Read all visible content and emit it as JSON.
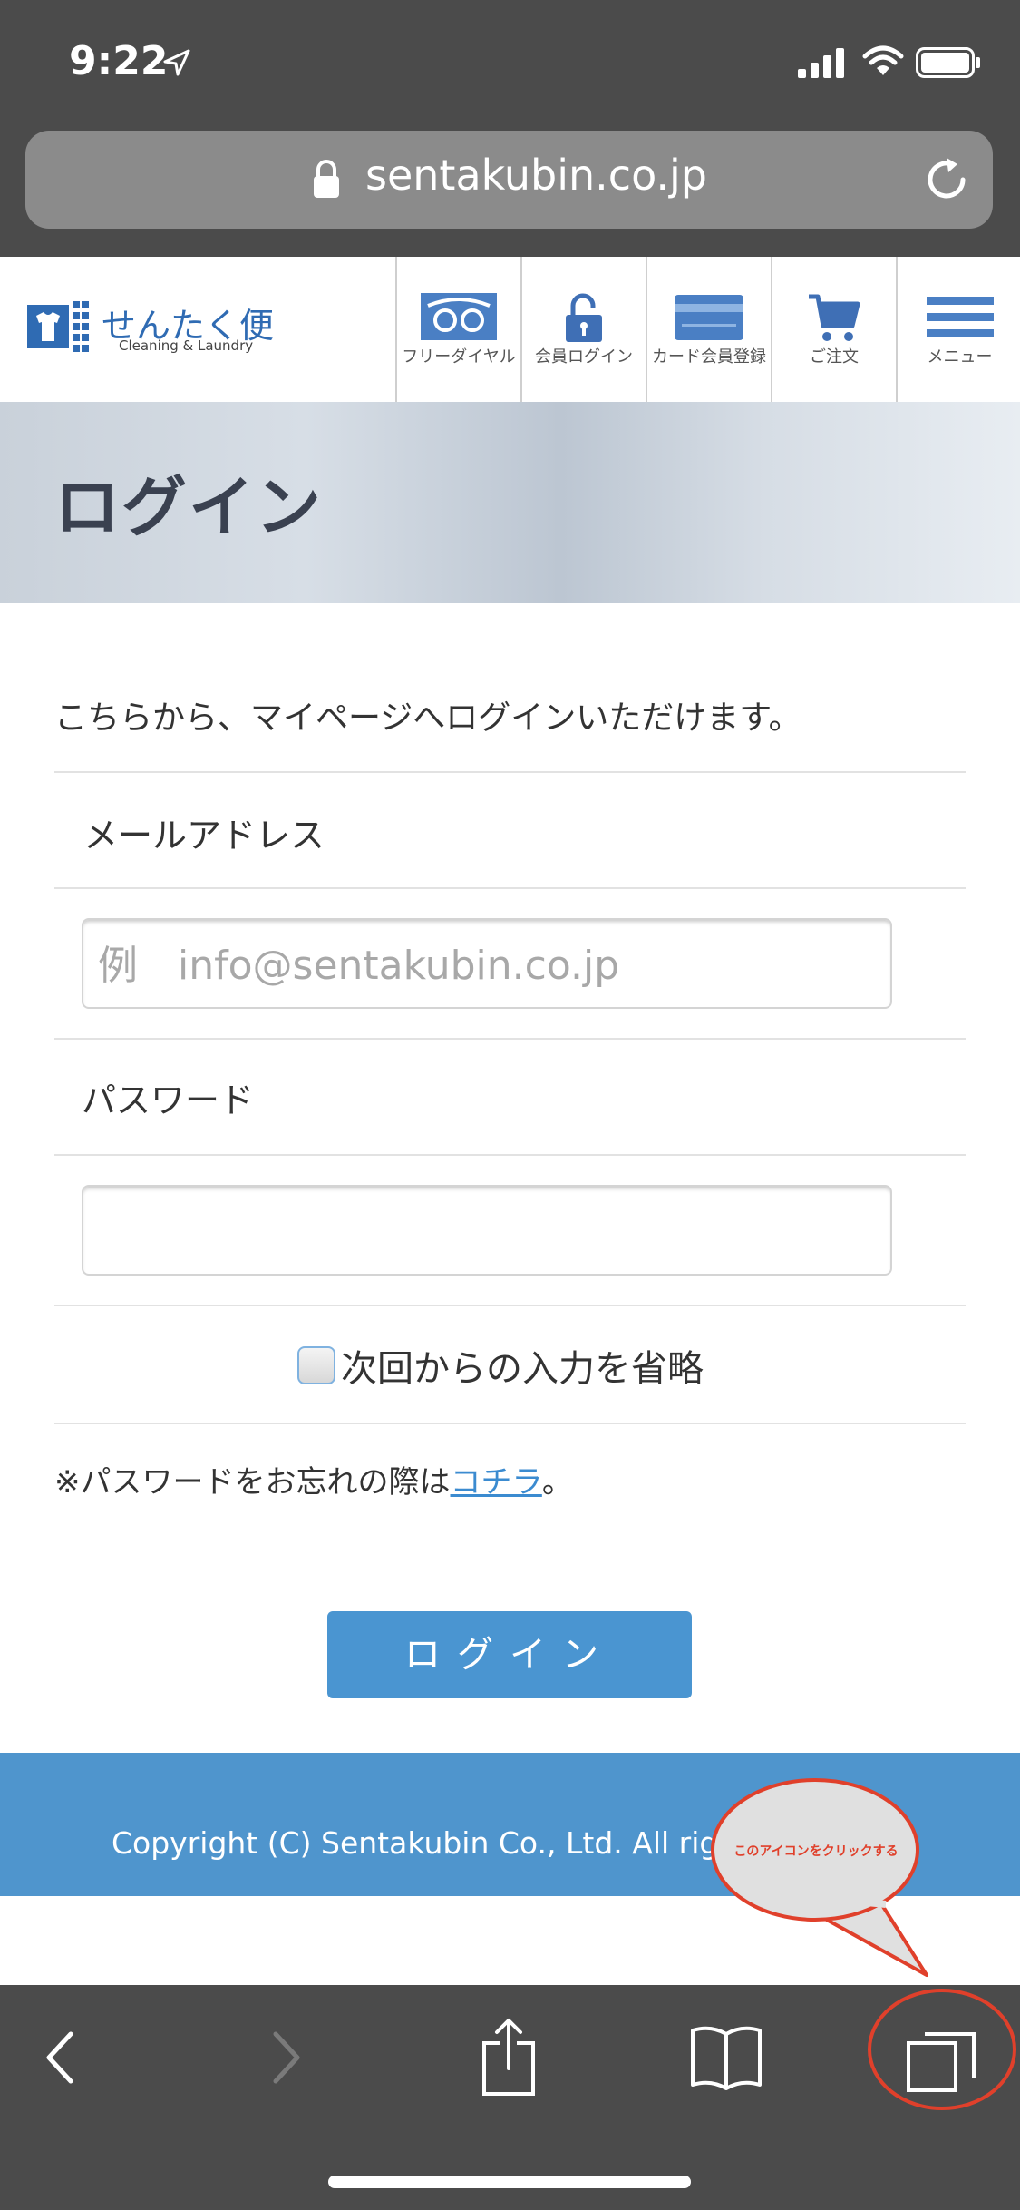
{
  "status_bar": {
    "time": "9:22"
  },
  "browser": {
    "url": "sentakubin.co.jp"
  },
  "site": {
    "logo_text": "せんたく便",
    "logo_sub": "Cleaning & Laundry",
    "nav": [
      {
        "label": "フリーダイヤル",
        "icon": "freedial-icon"
      },
      {
        "label": "会員ログイン",
        "icon": "unlock-icon"
      },
      {
        "label": "カード会員登録",
        "icon": "card-icon"
      },
      {
        "label": "ご注文",
        "icon": "cart-icon"
      },
      {
        "label": "メニュー",
        "icon": "menu-icon"
      }
    ],
    "accent": "#4a95d1",
    "logo_color": "#2f6bb3"
  },
  "hero": {
    "title": "ログイン"
  },
  "form": {
    "intro": "こちらから、マイページへログインいただけます。",
    "email_label": "メールアドレス",
    "email_placeholder": "例　info@sentakubin.co.jp",
    "password_label": "パスワード",
    "remember_label": "次回からの入力を省略",
    "forgot_prefix": "※パスワードをお忘れの際は",
    "forgot_link": "コチラ",
    "forgot_suffix": "。",
    "login_button": "ログイン"
  },
  "footer": {
    "copyright": "Copyright (C) Sentakubin Co., Ltd. All rig"
  },
  "annotation": {
    "callout_text": "このアイコンをクリックする",
    "color": "#e0402b"
  }
}
